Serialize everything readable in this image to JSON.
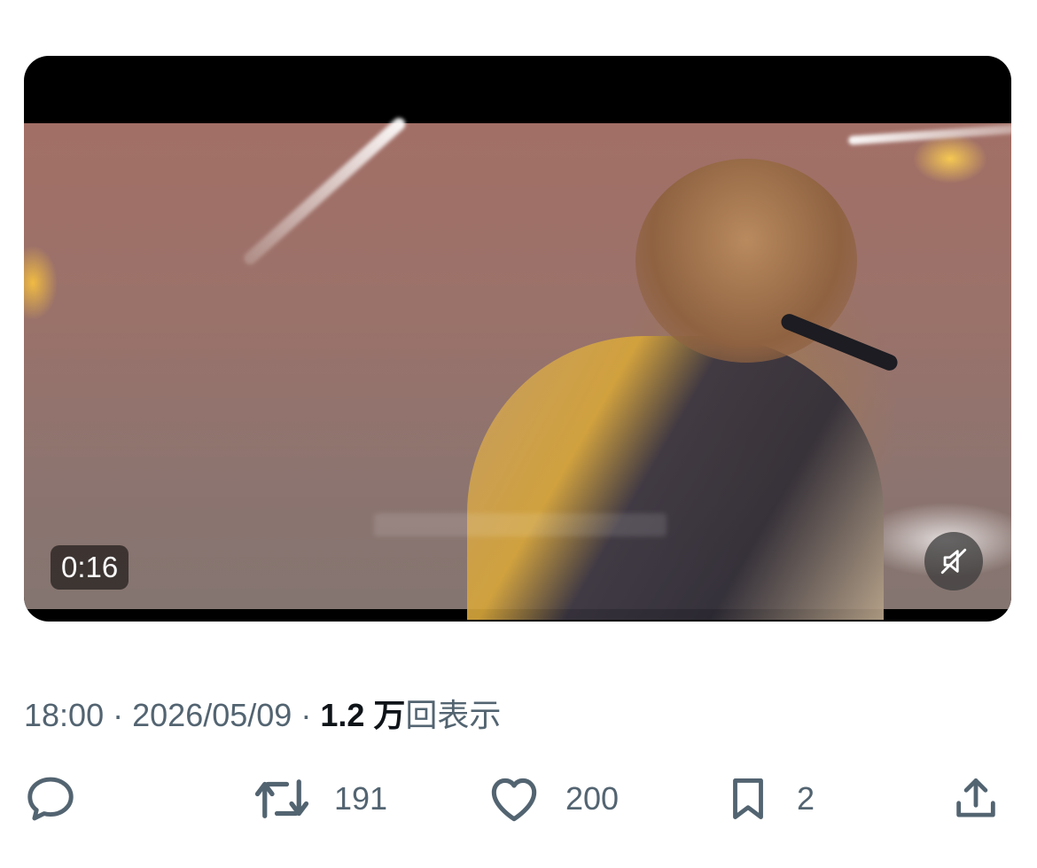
{
  "video": {
    "time": "0:16",
    "mute_icon": "speaker-muted-icon"
  },
  "tweet": {
    "time": "18:00",
    "separator": "·",
    "date": "2026/05/09",
    "views_num": "1.2 万",
    "views_label": "回表示"
  },
  "actions": {
    "reply": {
      "icon": "reply-icon",
      "count": ""
    },
    "retweet": {
      "icon": "retweet-icon",
      "count": "191"
    },
    "like": {
      "icon": "heart-icon",
      "count": "200"
    },
    "bookmark": {
      "icon": "bookmark-icon",
      "count": "2"
    },
    "share": {
      "icon": "share-icon"
    }
  },
  "colors": {
    "secondary_text": "#536471",
    "primary_text": "#0f1419",
    "video_bg": "#000000"
  }
}
